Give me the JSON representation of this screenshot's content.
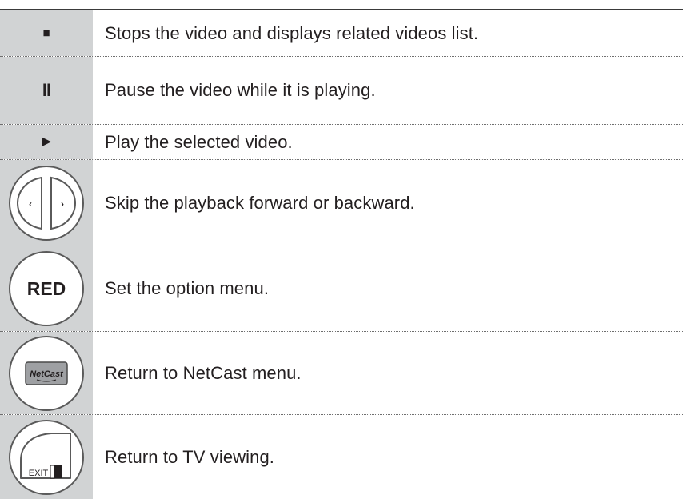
{
  "rows": [
    {
      "icon": "stop-icon",
      "symbol": "■",
      "text": "Stops the video and displays related videos list."
    },
    {
      "icon": "pause-icon",
      "symbol": "II",
      "text": "Pause the video while it is playing."
    },
    {
      "icon": "play-icon",
      "symbol": "►",
      "text": "Play the selected video."
    },
    {
      "icon": "left-right-skip-icon",
      "text": "Skip the playback forward or backward."
    },
    {
      "icon": "red-button-icon",
      "symbol": "RED",
      "text": "Set the option menu."
    },
    {
      "icon": "netcast-button-icon",
      "symbol": "NetCast",
      "text": "Return to NetCast menu."
    },
    {
      "icon": "exit-button-icon",
      "symbol": "EXIT",
      "text": "Return to TV viewing."
    }
  ]
}
